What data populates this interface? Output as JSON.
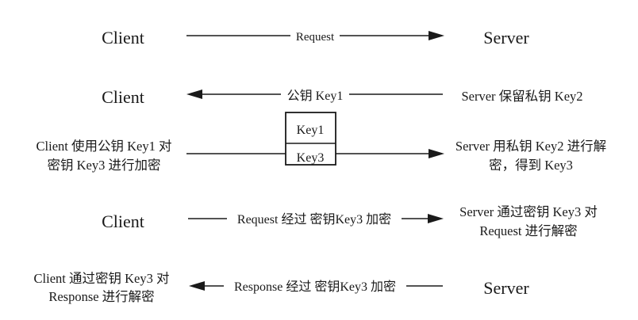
{
  "rows": [
    {
      "left": [
        "Client"
      ],
      "label": "Request",
      "right": [
        "Server"
      ],
      "direction": "right"
    },
    {
      "left": [
        "Client"
      ],
      "label": "公钥 Key1",
      "right": [
        "Server 保留私钥 Key2"
      ],
      "direction": "left"
    },
    {
      "left": [
        "Client 使用公钥 Key1 对",
        "密钥 Key3 进行加密"
      ],
      "label": "",
      "right": [
        "Server 用私钥 Key2 进行解",
        "密，得到 Key3"
      ],
      "direction": "right"
    },
    {
      "left": [
        "Client"
      ],
      "label": "Request 经过 密钥Key3 加密",
      "right": [
        "Server 通过密钥 Key3 对",
        "Request 进行解密"
      ],
      "direction": "right"
    },
    {
      "left": [
        "Client 通过密钥 Key3 对",
        "Response 进行解密"
      ],
      "label": "Response 经过 密钥Key3 加密",
      "right": [
        "Server"
      ],
      "direction": "left"
    }
  ],
  "key_box": {
    "top": "Key1",
    "bottom": "Key3"
  }
}
